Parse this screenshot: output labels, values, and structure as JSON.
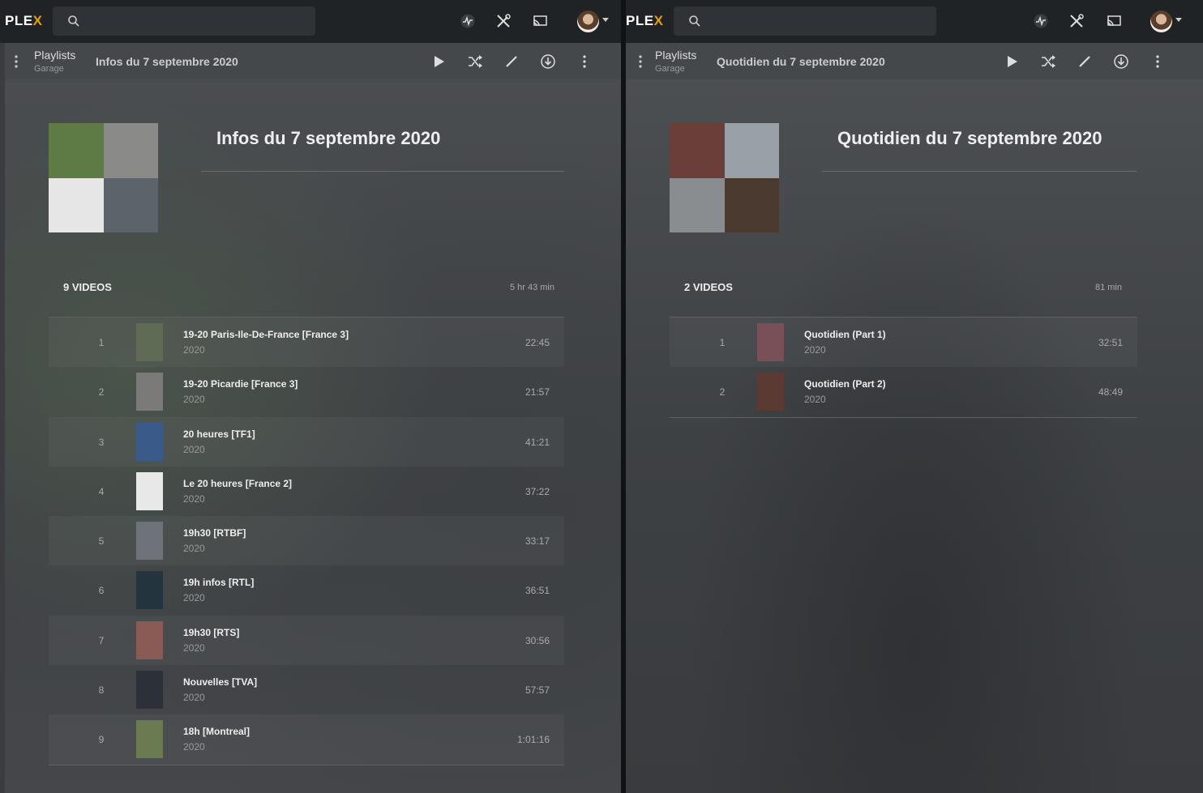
{
  "left": {
    "logo": "PLEX",
    "breadcrumb_title": "Playlists",
    "breadcrumb_sub": "Garage",
    "subtitle": "Infos du 7 septembre 2020",
    "title": "Infos du 7 septembre 2020",
    "count": "9 VIDEOS",
    "duration": "5 hr 43 min",
    "items": [
      {
        "num": "1",
        "title": "19-20 Paris-Ile-De-France [France 3]",
        "year": "2020",
        "duration": "22:45",
        "color": "#5f6b55"
      },
      {
        "num": "2",
        "title": "19-20 Picardie [France 3]",
        "year": "2020",
        "duration": "21:57",
        "color": "#7a7b78"
      },
      {
        "num": "3",
        "title": "20 heures [TF1]",
        "year": "2020",
        "duration": "41:21",
        "color": "#3a5a8a"
      },
      {
        "num": "4",
        "title": "Le 20 heures [France 2]",
        "year": "2020",
        "duration": "37:22",
        "color": "#e8e8e8"
      },
      {
        "num": "5",
        "title": "19h30 [RTBF]",
        "year": "2020",
        "duration": "33:17",
        "color": "#6d7378"
      },
      {
        "num": "6",
        "title": "19h infos [RTL]",
        "year": "2020",
        "duration": "36:51",
        "color": "#23343f"
      },
      {
        "num": "7",
        "title": "19h30 [RTS]",
        "year": "2020",
        "duration": "30:56",
        "color": "#8a5a55"
      },
      {
        "num": "8",
        "title": "Nouvelles [TVA]",
        "year": "2020",
        "duration": "57:57",
        "color": "#2c3038"
      },
      {
        "num": "9",
        "title": "18h [Montreal]",
        "year": "2020",
        "duration": "1:01:16",
        "color": "#6b7a50"
      }
    ],
    "poster_colors": [
      "#5e7a45",
      "#8a8a88",
      "#e6e6e6",
      "#5c636a"
    ]
  },
  "right": {
    "logo": "PLEX",
    "breadcrumb_title": "Playlists",
    "breadcrumb_sub": "Garage",
    "subtitle": "Quotidien du 7 septembre 2020",
    "title": "Quotidien du 7 septembre 2020",
    "count": "2 VIDEOS",
    "duration": "81 min",
    "items": [
      {
        "num": "1",
        "title": "Quotidien (Part 1)",
        "year": "2020",
        "duration": "32:51",
        "color": "#7a5058"
      },
      {
        "num": "2",
        "title": "Quotidien (Part 2)",
        "year": "2020",
        "duration": "48:49",
        "color": "#5a3a32"
      }
    ],
    "poster_colors": [
      "#6b3e3a",
      "#9aa0a8",
      "#8a8d90",
      "#4a3a30"
    ]
  },
  "colors": {
    "accent": "#e5a00d",
    "topbar": "#1f2326"
  }
}
